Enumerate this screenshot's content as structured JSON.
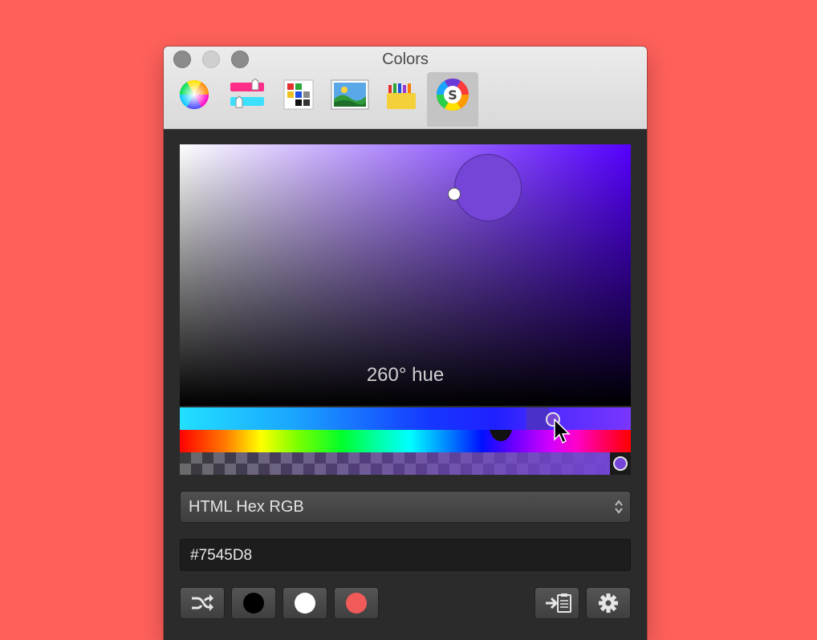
{
  "window": {
    "title": "Colors"
  },
  "toolbar": {
    "items": [
      {
        "name": "color-wheel",
        "active": false
      },
      {
        "name": "color-sliders",
        "active": false
      },
      {
        "name": "color-palettes",
        "active": false
      },
      {
        "name": "image-palettes",
        "active": false
      },
      {
        "name": "pencils",
        "active": false
      },
      {
        "name": "skala-picker",
        "active": true
      }
    ]
  },
  "picker": {
    "hue_label": "260° hue",
    "current_color": "#7545D8"
  },
  "format": {
    "selected": "HTML Hex RGB"
  },
  "hex": {
    "value": "#7545D8"
  },
  "swatches": {
    "colors": [
      "#000000",
      "#ffffff",
      "#f05a58"
    ]
  }
}
